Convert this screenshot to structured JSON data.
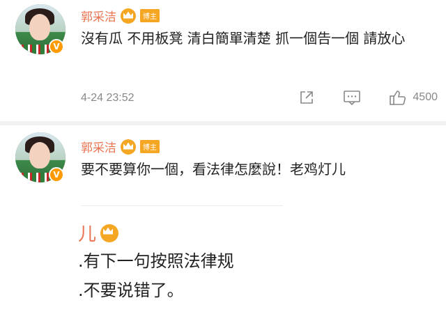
{
  "comments": [
    {
      "username": "郭采洁",
      "badge": "博主",
      "text": "沒有瓜 不用板凳 清白簡單清楚 抓一個告一個 請放心",
      "timestamp": "4-24 23:52",
      "like_count": "4500"
    },
    {
      "username": "郭采洁",
      "badge": "博主",
      "text": "要不要算你一個，看法律怎麼說！老鸡灯儿"
    }
  ],
  "reply_preview": {
    "username": "儿",
    "lines": [
      ".有下一句按照法律规",
      ".不要说错了。"
    ]
  },
  "icons": {
    "verified": "v-badge-icon",
    "crown": "crown-icon",
    "share": "share-icon",
    "comment": "comment-icon",
    "like": "thumbs-up-icon"
  },
  "colors": {
    "username": "#eb7350",
    "badge": "#f5a623",
    "verified": "#ff9a00",
    "meta": "#888888"
  }
}
